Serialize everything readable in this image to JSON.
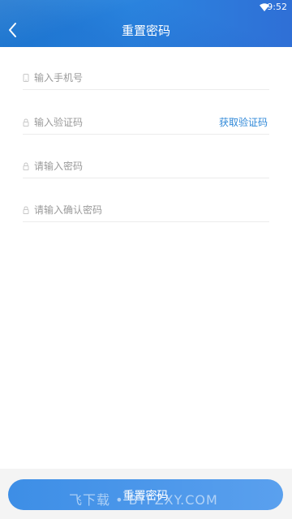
{
  "status_bar": {
    "time": "9:52",
    "wifi_icon": "wifi-icon"
  },
  "header": {
    "title": "重置密码",
    "back_icon": "chevron-left-icon"
  },
  "form": {
    "phone": {
      "placeholder": "输入手机号",
      "icon": "phone-icon"
    },
    "code": {
      "placeholder": "输入验证码",
      "icon": "lock-icon",
      "get_code_label": "获取验证码"
    },
    "password": {
      "placeholder": "请输入密码",
      "icon": "lock-icon"
    },
    "confirm": {
      "placeholder": "请输入确认密码",
      "icon": "lock-icon"
    }
  },
  "submit": {
    "label": "重置密码"
  },
  "watermark": "飞下载 • BYFZXY.COM",
  "colors": {
    "header_start": "#1f7fd6",
    "header_end": "#2f6fd6",
    "link": "#2f88d8",
    "button": "#4a96ea"
  }
}
